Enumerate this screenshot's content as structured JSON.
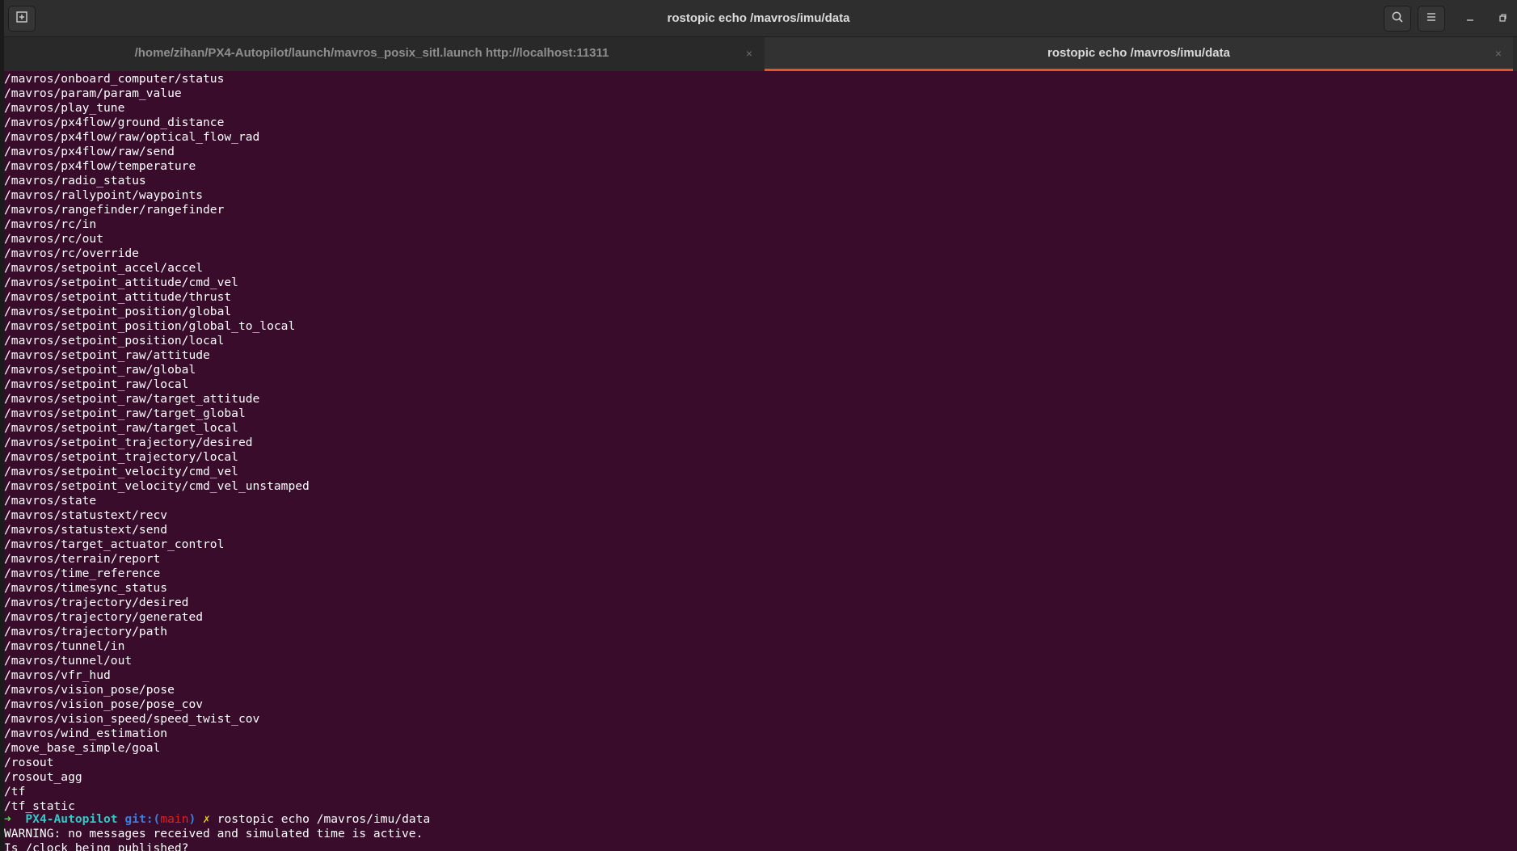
{
  "window": {
    "title": "rostopic echo /mavros/imu/data"
  },
  "tabs": [
    {
      "label": "/home/zihan/PX4-Autopilot/launch/mavros_posix_sitl.launch http://localhost:11311",
      "active": false,
      "close": "×"
    },
    {
      "label": "rostopic echo /mavros/imu/data",
      "active": true,
      "close": "×"
    }
  ],
  "colors": {
    "terminal_bg": "#380c2a",
    "accent": "#e95420",
    "prompt_arrow": "#4ee44e",
    "prompt_dir": "#34c8c8",
    "prompt_git": "#3a7fe0",
    "prompt_branch": "#e02020",
    "prompt_dirty": "#e8c830"
  },
  "icons": {
    "new_tab": "new-tab-icon",
    "search": "search-icon",
    "menu": "hamburger-menu-icon",
    "minimize": "minimize-icon",
    "maximize": "maximize-icon"
  },
  "terminal": {
    "lines": [
      "/mavros/onboard_computer/status",
      "/mavros/param/param_value",
      "/mavros/play_tune",
      "/mavros/px4flow/ground_distance",
      "/mavros/px4flow/raw/optical_flow_rad",
      "/mavros/px4flow/raw/send",
      "/mavros/px4flow/temperature",
      "/mavros/radio_status",
      "/mavros/rallypoint/waypoints",
      "/mavros/rangefinder/rangefinder",
      "/mavros/rc/in",
      "/mavros/rc/out",
      "/mavros/rc/override",
      "/mavros/setpoint_accel/accel",
      "/mavros/setpoint_attitude/cmd_vel",
      "/mavros/setpoint_attitude/thrust",
      "/mavros/setpoint_position/global",
      "/mavros/setpoint_position/global_to_local",
      "/mavros/setpoint_position/local",
      "/mavros/setpoint_raw/attitude",
      "/mavros/setpoint_raw/global",
      "/mavros/setpoint_raw/local",
      "/mavros/setpoint_raw/target_attitude",
      "/mavros/setpoint_raw/target_global",
      "/mavros/setpoint_raw/target_local",
      "/mavros/setpoint_trajectory/desired",
      "/mavros/setpoint_trajectory/local",
      "/mavros/setpoint_velocity/cmd_vel",
      "/mavros/setpoint_velocity/cmd_vel_unstamped",
      "/mavros/state",
      "/mavros/statustext/recv",
      "/mavros/statustext/send",
      "/mavros/target_actuator_control",
      "/mavros/terrain/report",
      "/mavros/time_reference",
      "/mavros/timesync_status",
      "/mavros/trajectory/desired",
      "/mavros/trajectory/generated",
      "/mavros/trajectory/path",
      "/mavros/tunnel/in",
      "/mavros/tunnel/out",
      "/mavros/vfr_hud",
      "/mavros/vision_pose/pose",
      "/mavros/vision_pose/pose_cov",
      "/mavros/vision_speed/speed_twist_cov",
      "/mavros/wind_estimation",
      "/move_base_simple/goal",
      "/rosout",
      "/rosout_agg",
      "/tf",
      "/tf_static"
    ],
    "prompt": {
      "arrow": "➜",
      "dir": "PX4-Autopilot",
      "git_prefix": "git:(",
      "branch": "main",
      "git_suffix": ")",
      "dirty": "✗",
      "command": "rostopic echo /mavros/imu/data"
    },
    "output": [
      "WARNING: no messages received and simulated time is active.",
      "Is /clock being published?"
    ]
  }
}
